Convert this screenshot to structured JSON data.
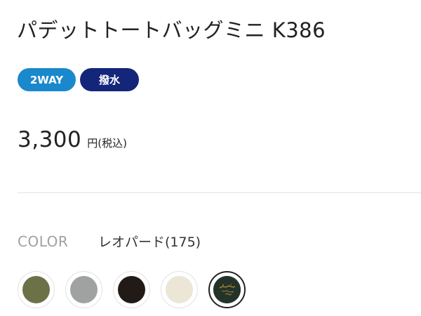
{
  "product": {
    "title": "パデットトートバッグミニ K386",
    "tags": [
      "2WAY",
      "撥水"
    ],
    "price": "3,300",
    "price_unit": "円(税込)"
  },
  "color_selector": {
    "label": "COLOR",
    "selected_name": "レオパード(175)",
    "swatches": [
      {
        "color": "#6d7148"
      },
      {
        "color": "#a0a1a1"
      },
      {
        "color": "#221a17"
      },
      {
        "color": "#ebe6d6"
      },
      {
        "color": "#233329",
        "pattern": "leopard",
        "selected": true
      }
    ]
  },
  "colors": {
    "tag_2way": "#1a88cc",
    "tag_water": "#13267a"
  }
}
